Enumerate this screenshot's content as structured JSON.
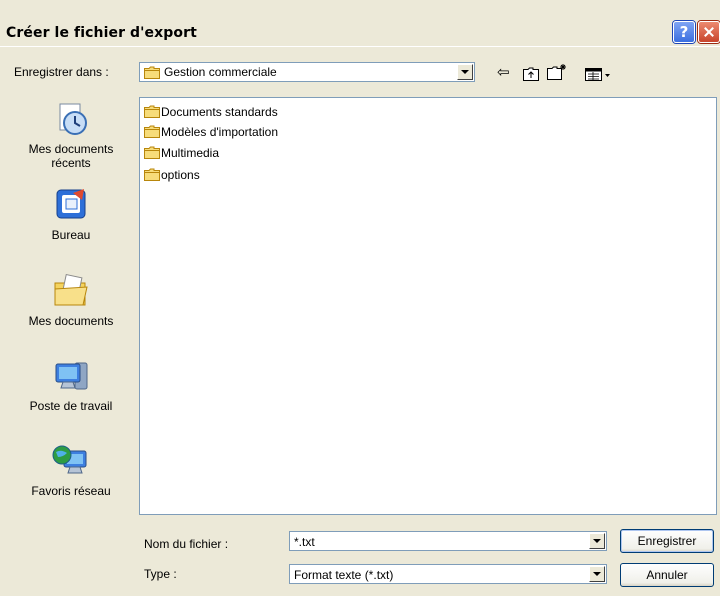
{
  "window": {
    "title": "Créer le fichier d'export"
  },
  "toolbar": {
    "save_in_label": "Enregistrer dans :",
    "save_in_value": "Gestion commerciale",
    "back_glyph": "⇦",
    "up_folder_glyph": "⮤",
    "new_folder_glyph": "✳",
    "views_glyph": "▦▾"
  },
  "places": [
    {
      "label": "Mes documents\nrécents",
      "icon": "recent-documents-icon"
    },
    {
      "label": "Bureau",
      "icon": "desktop-icon"
    },
    {
      "label": "Mes documents",
      "icon": "my-documents-icon"
    },
    {
      "label": "Poste de travail",
      "icon": "my-computer-icon"
    },
    {
      "label": "Favoris réseau",
      "icon": "network-places-icon"
    }
  ],
  "files": [
    {
      "name": "Documents standards"
    },
    {
      "name": "Modèles d'importation"
    },
    {
      "name": "Multimedia"
    },
    {
      "name": "options"
    }
  ],
  "form": {
    "filename_label": "Nom du fichier :",
    "filename_value": "*.txt",
    "type_label": "Type :",
    "type_value": "Format texte (*.txt)"
  },
  "buttons": {
    "save": "Enregistrer",
    "cancel": "Annuler"
  },
  "colors": {
    "face": "#ece9d8",
    "border": "#7f9db9",
    "folder": "#f4d35e"
  }
}
